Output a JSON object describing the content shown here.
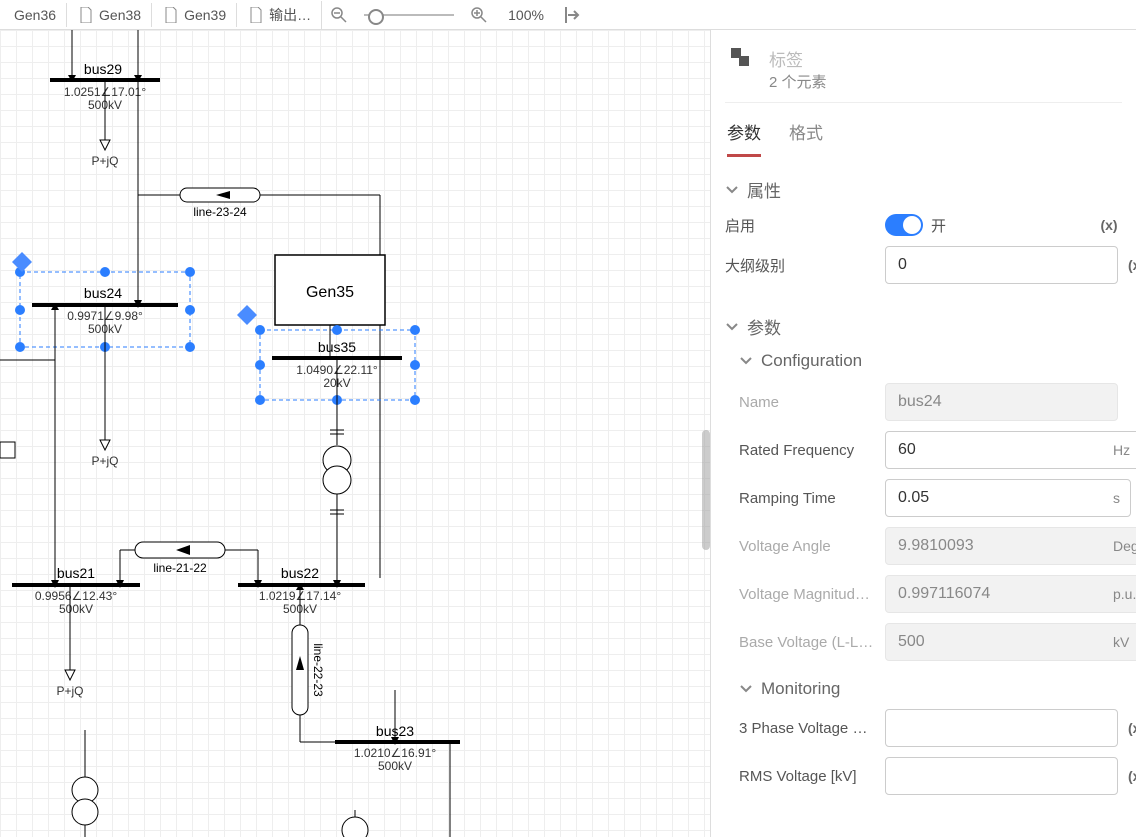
{
  "toolbar": {
    "tabs": [
      "Gen36",
      "Gen38",
      "Gen39",
      "输出…"
    ],
    "zoom_label": "100%"
  },
  "panel": {
    "header_placeholder": "标签",
    "header_sub": "2 个元素",
    "tab_params": "参数",
    "tab_format": "格式",
    "sec_attr": "属性",
    "enable_label": "启用",
    "enable_state": "开",
    "outline_label": "大纲级别",
    "outline_value": "0",
    "sec_params": "参数",
    "sec_config": "Configuration",
    "config": {
      "name_label": "Name",
      "name_value": "bus24",
      "freq_label": "Rated Frequency",
      "freq_value": "60",
      "freq_unit": "Hz",
      "ramp_label": "Ramping Time",
      "ramp_value": "0.05",
      "ramp_unit": "s",
      "vang_label": "Voltage Angle",
      "vang_value": "9.9810093",
      "vang_unit": "Deg",
      "vmag_label": "Voltage Magnitude …",
      "vmag_value": "0.997116074",
      "vmag_unit": "p.u.",
      "vbase_label": "Base Voltage (L-L, …",
      "vbase_value": "500",
      "vbase_unit": "kV"
    },
    "sec_monitor": "Monitoring",
    "monitor": {
      "ph3_label": "3 Phase Voltage Ve…",
      "rms_label": "RMS Voltage [kV]"
    },
    "x_label": "(x)"
  },
  "diagram": {
    "bus29": {
      "name": "bus29",
      "line1": "1.0251∠17.01°",
      "line2": "500kV",
      "load": "P+jQ"
    },
    "bus24": {
      "name": "bus24",
      "line1": "0.9971∠9.98°",
      "line2": "500kV",
      "load": "P+jQ"
    },
    "bus35": {
      "name": "bus35",
      "line1": "1.0490∠22.11°",
      "line2": "20kV"
    },
    "bus21": {
      "name": "bus21",
      "line1": "0.9956∠12.43°",
      "line2": "500kV",
      "load": "P+jQ"
    },
    "bus22": {
      "name": "bus22",
      "line1": "1.0219∠17.14°",
      "line2": "500kV"
    },
    "bus23": {
      "name": "bus23",
      "line1": "1.0210∠16.91°",
      "line2": "500kV"
    },
    "gen35": "Gen35",
    "line_23_24": "line-23-24",
    "line_21_22": "line-21-22",
    "line_22_23": "line-22-23"
  }
}
